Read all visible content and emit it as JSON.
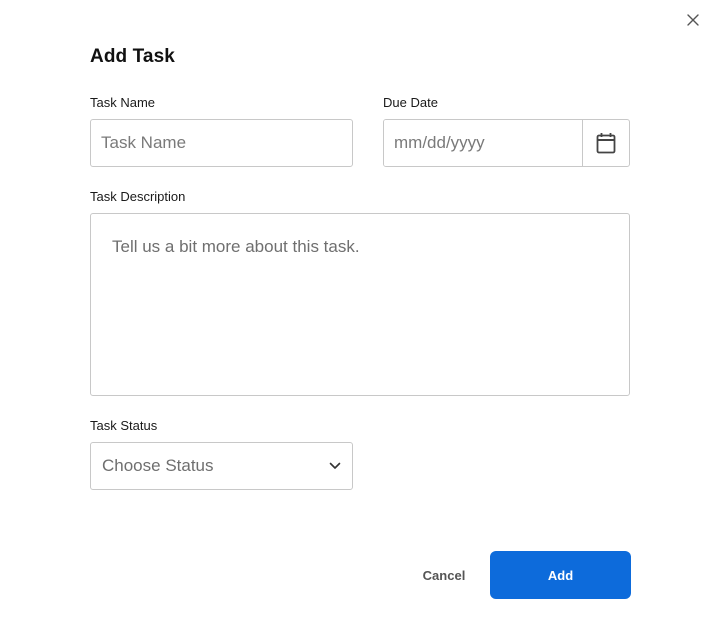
{
  "dialog": {
    "title": "Add Task",
    "close_icon": "close-icon"
  },
  "fields": {
    "task_name": {
      "label": "Task Name",
      "placeholder": "Task Name",
      "value": ""
    },
    "due_date": {
      "label": "Due Date",
      "placeholder": "mm/dd/yyyy",
      "value": "",
      "icon": "calendar-icon"
    },
    "task_description": {
      "label": "Task Description",
      "placeholder": "Tell us a bit more about this task.",
      "value": ""
    },
    "task_status": {
      "label": "Task Status",
      "selected": "Choose Status",
      "icon": "chevron-down-icon"
    }
  },
  "actions": {
    "cancel_label": "Cancel",
    "add_label": "Add"
  },
  "colors": {
    "primary": "#0d6bdb",
    "border": "#c8c8c8",
    "placeholder": "#7a7a7a"
  }
}
